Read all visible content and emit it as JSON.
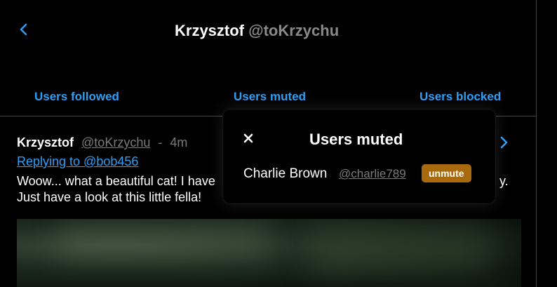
{
  "header": {
    "name": "Krzysztof",
    "handle": "@toKrzychu"
  },
  "tabs": [
    {
      "label": "Users followed"
    },
    {
      "label": "Users muted"
    },
    {
      "label": "Users blocked"
    }
  ],
  "post": {
    "author_name": "Krzysztof",
    "author_handle": "@toKrzychu",
    "separator": "-",
    "time": "4m",
    "reply_text": "Replying to @bob456",
    "text": "Woow... what a beautiful cat! I have",
    "text_tail": "y.",
    "text_line2": "Just have a look at this little fella!"
  },
  "modal": {
    "title": "Users muted",
    "users": [
      {
        "name": "Charlie Brown",
        "handle": "@charlie789",
        "action": "unmute"
      }
    ]
  },
  "colors": {
    "accent": "#2f9ef4",
    "muted_text": "#7a7a7a",
    "unmute_button": "#a86a0c",
    "background": "#000000"
  },
  "icons": {
    "back": "chevron-left-icon",
    "next": "chevron-right-icon",
    "close": "close-icon"
  }
}
